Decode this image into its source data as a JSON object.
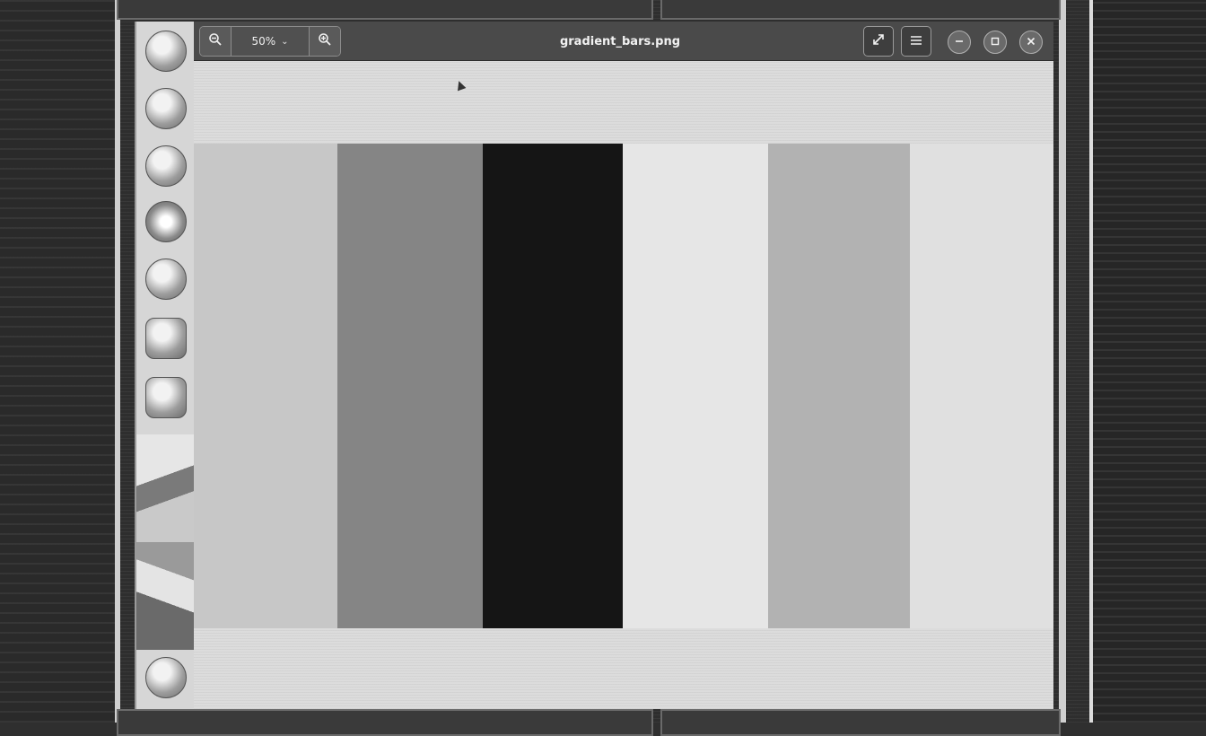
{
  "window": {
    "title": "gradient_bars.png"
  },
  "headerbar": {
    "zoom_out_icon": "zoom-out-icon",
    "zoom_level": "50%",
    "zoom_in_icon": "zoom-in-icon",
    "fullscreen_icon": "fullscreen-icon",
    "menu_icon": "hamburger-menu-icon",
    "minimize_icon": "minimize-icon",
    "maximize_icon": "maximize-icon",
    "close_icon": "close-icon"
  },
  "dock": {
    "items": [
      {
        "name": "browser",
        "icon": "browser-icon"
      },
      {
        "name": "app",
        "icon": "app-icon"
      },
      {
        "name": "files",
        "icon": "files-icon"
      },
      {
        "name": "image-viewer",
        "icon": "image-viewer-icon",
        "active": true
      },
      {
        "name": "paint",
        "icon": "paint-icon"
      },
      {
        "name": "store",
        "icon": "store-icon"
      },
      {
        "name": "terminal",
        "icon": "terminal-icon"
      },
      {
        "name": "settings",
        "icon": "settings-icon"
      }
    ]
  },
  "image": {
    "bars": [
      {
        "color": "#c7c7c7"
      },
      {
        "color": "#858585"
      },
      {
        "color": "#151515"
      },
      {
        "color": "#e6e6e6"
      },
      {
        "color": "#b2b2b2"
      },
      {
        "color": "#e0e0e0"
      }
    ]
  }
}
